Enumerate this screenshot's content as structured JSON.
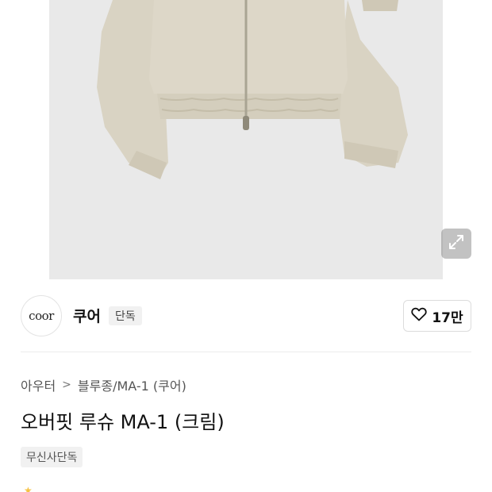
{
  "image": {
    "expand_icon": "expand-arrows-icon"
  },
  "brand": {
    "logo_text": "coor",
    "name": "쿠어",
    "badge": "단독"
  },
  "like": {
    "icon": "heart-outline-icon",
    "count": "17만"
  },
  "breadcrumb": {
    "category": "아우터",
    "separator": ">",
    "subcategory": "블루종/MA-1 (쿠어)"
  },
  "product": {
    "title": "오버핏 루슈 MA-1 (크림)",
    "tag": "무신사단독"
  },
  "colors": {
    "image_bg": "#e9e9e9",
    "jacket": "#ddd7c8",
    "badge_bg": "#f1f1f1",
    "star": "#f6c244"
  }
}
